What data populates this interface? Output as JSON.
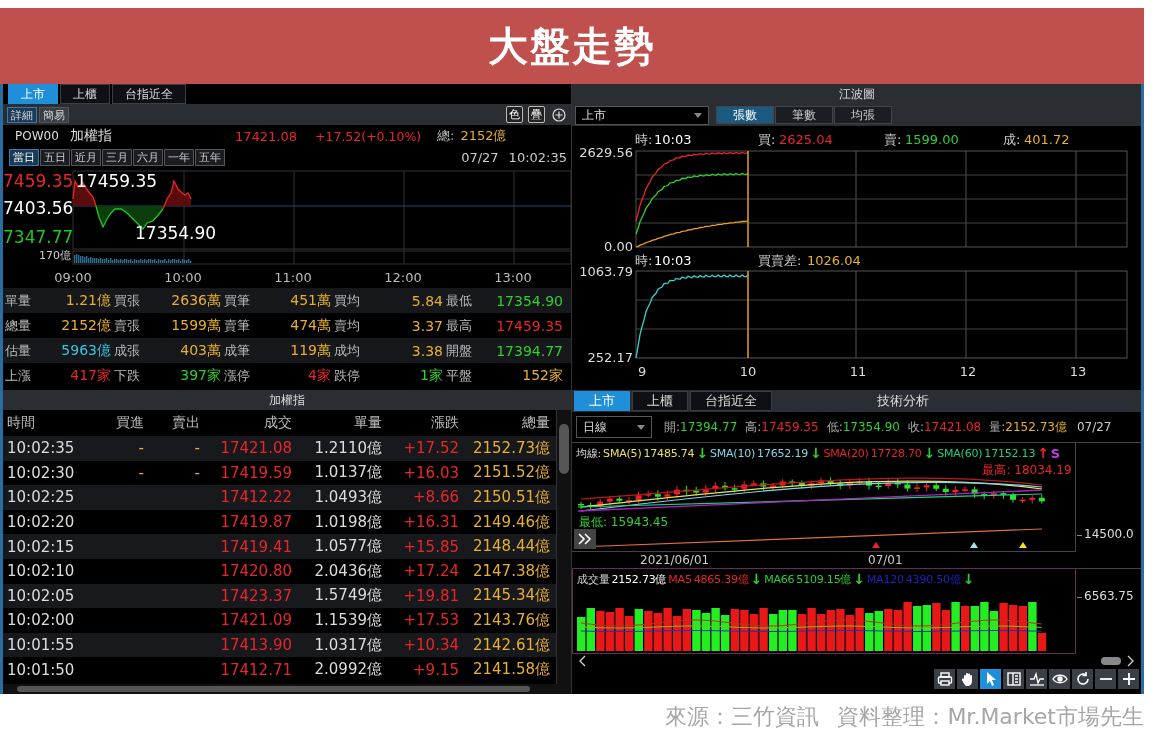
{
  "banner": {
    "title": "大盤走勢"
  },
  "quote_panel": {
    "market_tabs": [
      {
        "label": "上市",
        "selected": true
      },
      {
        "label": "上櫃",
        "selected": false
      },
      {
        "label": "台指近全",
        "selected": false
      }
    ],
    "view_tabs": [
      {
        "label": "詳細",
        "selected": true
      },
      {
        "label": "簡易",
        "selected": false
      }
    ],
    "tool_buttons": [
      "色",
      "疊"
    ],
    "code": "POW00",
    "name": "加權指",
    "price": "17421.08",
    "change": "+17.52(+0.10%)",
    "total_label": "總:",
    "total": "2152億",
    "range_tabs": [
      {
        "label": "當日",
        "selected": true
      },
      {
        "label": "五日",
        "selected": false
      },
      {
        "label": "近月",
        "selected": false
      },
      {
        "label": "三月",
        "selected": false
      },
      {
        "label": "六月",
        "selected": false
      },
      {
        "label": "一年",
        "selected": false
      },
      {
        "label": "五年",
        "selected": false
      }
    ],
    "date": "07/27",
    "time": "10:02:35",
    "chart": {
      "y_labels": [
        {
          "text": "7459.35",
          "color": "#e8262a"
        },
        {
          "text": "7403.56",
          "color": "#ffffff"
        },
        {
          "text": "7347.77",
          "color": "#1fc81f"
        }
      ],
      "high": "17459.35",
      "low": "17354.90",
      "volume_label": "170億",
      "x_labels": [
        "09:00",
        "10:00",
        "11:00",
        "12:00",
        "13:00"
      ]
    },
    "stats": [
      {
        "cells": [
          {
            "label": "單量",
            "value": "1.21億",
            "color": "#e8b030"
          },
          {
            "label": "買張",
            "value": "2636萬",
            "color": "#e8b030"
          },
          {
            "label": "買筆",
            "value": "451萬",
            "color": "#e8b030"
          },
          {
            "label": "買均",
            "value": "5.84",
            "color": "#e8b030"
          },
          {
            "label": "最低",
            "value": "17354.90",
            "color": "#2fd02f"
          }
        ]
      },
      {
        "cells": [
          {
            "label": "總量",
            "value": "2152億",
            "color": "#e8b030"
          },
          {
            "label": "賣張",
            "value": "1599萬",
            "color": "#e8b030"
          },
          {
            "label": "賣筆",
            "value": "474萬",
            "color": "#e8b030"
          },
          {
            "label": "賣均",
            "value": "3.37",
            "color": "#e8b030"
          },
          {
            "label": "最高",
            "value": "17459.35",
            "color": "#e8262a"
          }
        ]
      },
      {
        "cells": [
          {
            "label": "估量",
            "value": "5963億",
            "color": "#36c8e0"
          },
          {
            "label": "成張",
            "value": "403萬",
            "color": "#e8b030"
          },
          {
            "label": "成筆",
            "value": "119萬",
            "color": "#e8b030"
          },
          {
            "label": "成均",
            "value": "3.38",
            "color": "#e8b030"
          },
          {
            "label": "開盤",
            "value": "17394.77",
            "color": "#2fd02f"
          }
        ]
      },
      {
        "cells": [
          {
            "label": "上漲",
            "value": "417家",
            "color": "#e8262a"
          },
          {
            "label": "下跌",
            "value": "397家",
            "color": "#2fd02f"
          },
          {
            "label": "漲停",
            "value": "4家",
            "color": "#e8262a"
          },
          {
            "label": "跌停",
            "value": "1家",
            "color": "#2fd02f"
          },
          {
            "label": "平盤",
            "value": "152家",
            "color": "#e8b030"
          }
        ]
      }
    ]
  },
  "wave_panel": {
    "title": "江波圖",
    "market": "上市",
    "tabs": [
      {
        "label": "張數",
        "selected": true
      },
      {
        "label": "筆數",
        "selected": false
      },
      {
        "label": "均張",
        "selected": false
      }
    ],
    "top_header": [
      {
        "label": "時:",
        "value": "10:03",
        "color": "#ffffff"
      },
      {
        "label": "買:",
        "value": "2625.04",
        "color": "#e8262a"
      },
      {
        "label": "賣:",
        "value": "1599.00",
        "color": "#2fd02f"
      },
      {
        "label": "成:",
        "value": "401.72",
        "color": "#e8b030"
      }
    ],
    "top_y_labels": [
      "2629.56",
      "0.00"
    ],
    "bottom_header": [
      {
        "label": "時:",
        "value": "10:03",
        "color": "#ffffff"
      },
      {
        "label": "買賣差:",
        "value": "1026.04",
        "color": "#e8b030"
      }
    ],
    "bottom_y_labels": [
      "1063.79",
      "252.17"
    ],
    "x_labels": [
      "9",
      "10",
      "11",
      "12",
      "13"
    ]
  },
  "ticks_panel": {
    "title": "加權指",
    "columns": [
      "時間",
      "買進",
      "賣出",
      "成交",
      "單量",
      "漲跌",
      "總量"
    ],
    "rows": [
      {
        "time": "10:02:35",
        "buy": "-",
        "sell": "-",
        "price": "17421.08",
        "volume": "1.2110億",
        "change": "+17.52",
        "total": "2152.73億"
      },
      {
        "time": "10:02:30",
        "buy": "-",
        "sell": "-",
        "price": "17419.59",
        "volume": "1.0137億",
        "change": "+16.03",
        "total": "2151.52億"
      },
      {
        "time": "10:02:25",
        "price": "17412.22",
        "volume": "1.0493億",
        "change": "+8.66",
        "total": "2150.51億"
      },
      {
        "time": "10:02:20",
        "price": "17419.87",
        "volume": "1.0198億",
        "change": "+16.31",
        "total": "2149.46億"
      },
      {
        "time": "10:02:15",
        "price": "17419.41",
        "volume": "1.0577億",
        "change": "+15.85",
        "total": "2148.44億"
      },
      {
        "time": "10:02:10",
        "price": "17420.80",
        "volume": "2.0436億",
        "change": "+17.24",
        "total": "2147.38億"
      },
      {
        "time": "10:02:05",
        "price": "17423.37",
        "volume": "1.5749億",
        "change": "+19.81",
        "total": "2145.34億"
      },
      {
        "time": "10:02:00",
        "price": "17421.09",
        "volume": "1.1539億",
        "change": "+17.53",
        "total": "2143.76億"
      },
      {
        "time": "10:01:55",
        "price": "17413.90",
        "volume": "1.0317億",
        "change": "+10.34",
        "total": "2142.61億"
      },
      {
        "time": "10:01:50",
        "price": "17412.71",
        "volume": "2.0992億",
        "change": "+9.15",
        "total": "2141.58億"
      }
    ]
  },
  "tech_panel": {
    "tabs": [
      {
        "label": "上市",
        "selected": true
      },
      {
        "label": "上櫃",
        "selected": false
      },
      {
        "label": "台指近全",
        "selected": false
      }
    ],
    "title": "技術分析",
    "period": "日線",
    "ohlc": [
      {
        "label": "開:",
        "value": "17394.77",
        "color": "#2fd02f"
      },
      {
        "label": "高:",
        "value": "17459.35",
        "color": "#e8262a"
      },
      {
        "label": "低:",
        "value": "17354.90",
        "color": "#2fd02f"
      },
      {
        "label": "收:",
        "value": "17421.08",
        "color": "#e8262a"
      },
      {
        "label": "量:",
        "value": "2152.73億",
        "color": "#e8b030"
      }
    ],
    "date": "07/27",
    "ma_label": "均線:",
    "ma": [
      {
        "name": "SMA(5)",
        "value": "17485.74",
        "arrow": {
          "text": "↓",
          "color": "#2fd02f"
        },
        "color": "#e8e060"
      },
      {
        "name": "SMA(10)",
        "value": "17652.19",
        "arrow": {
          "text": "↓",
          "color": "#2fd02f"
        },
        "color": "#7fd8e8"
      },
      {
        "name": "SMA(20)",
        "value": "17728.70",
        "arrow": {
          "text": "↓",
          "color": "#2fd02f"
        },
        "color": "#e8262a"
      },
      {
        "name": "SMA(60)",
        "value": "17152.13",
        "arrow": {
          "text": "↑",
          "color": "#e8262a"
        },
        "color": "#20d080"
      },
      {
        "name": "S",
        "color": "#c040e0"
      }
    ],
    "high_label": "最高: 18034.19",
    "low_label": "最低: 15943.45",
    "y_label": "14500.0",
    "x_labels": [
      "2021/06/01",
      "07/01"
    ],
    "volume_label": "成交量",
    "volume_value": "2152.73億",
    "volume_ma": [
      {
        "name": "MA5",
        "value": "4865.39億",
        "arrow": {
          "text": "↓",
          "color": "#2fd02f"
        },
        "color": "#e8262a"
      },
      {
        "name": "MA66",
        "value": "5109.15億",
        "arrow": {
          "text": "↓",
          "color": "#2fd02f"
        },
        "color": "#2fd02f"
      },
      {
        "name": "MA120",
        "value": "4390.50億",
        "arrow": {
          "text": "↓",
          "color": "#2fd02f"
        },
        "color": "#2020c0"
      }
    ],
    "volume_y_label": "6563.75",
    "toolbar": [
      {
        "kind": "print",
        "selected": false
      },
      {
        "kind": "hand",
        "selected": false
      },
      {
        "kind": "pointer",
        "selected": true
      },
      {
        "kind": "layout",
        "selected": false
      },
      {
        "kind": "chart",
        "selected": false
      },
      {
        "kind": "eye",
        "selected": false
      },
      {
        "kind": "refresh",
        "selected": false
      },
      {
        "kind": "minus",
        "selected": false
      },
      {
        "kind": "plus",
        "selected": false
      }
    ]
  },
  "footer": [
    "來源：三竹資訊",
    "資料整理：Mr.Market市場先生"
  ]
}
